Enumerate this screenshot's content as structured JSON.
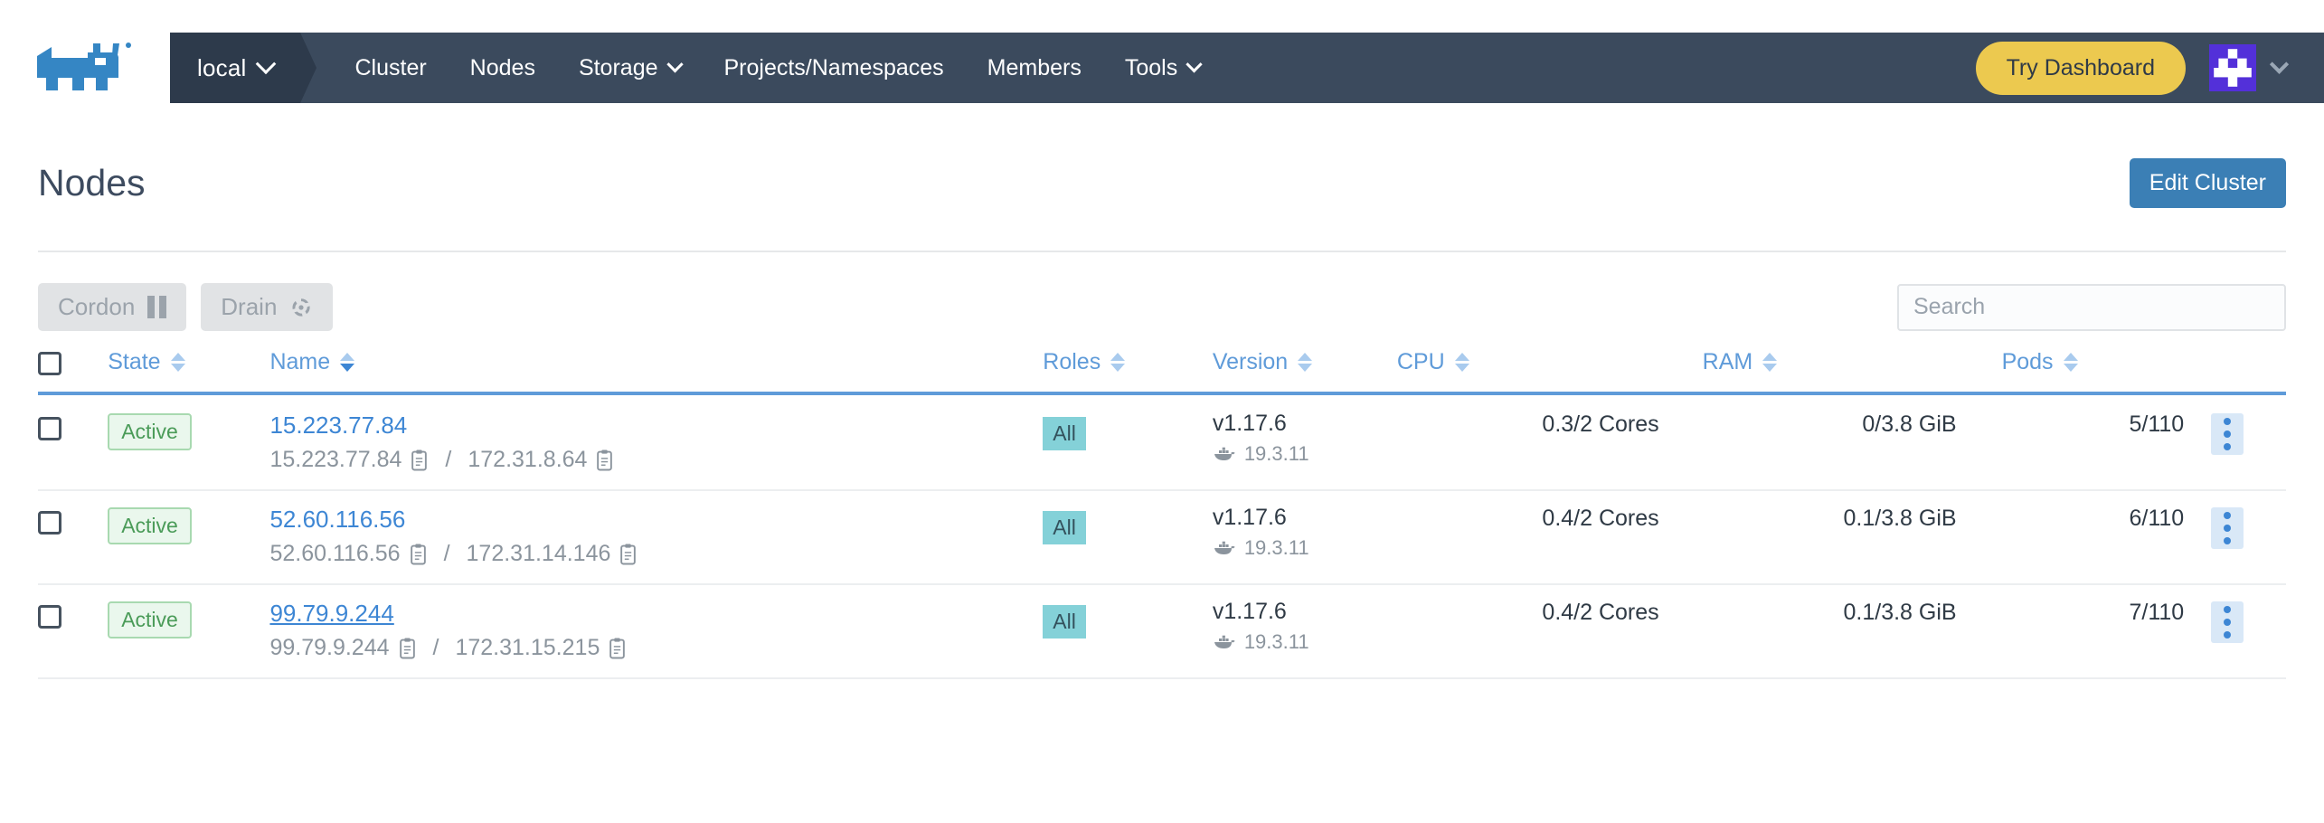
{
  "nav": {
    "logo_icon": "rancher-bull-logo",
    "cluster_selector": {
      "label": "local",
      "icon": "chevron-down-icon"
    },
    "items": [
      {
        "label": "Cluster",
        "has_dropdown": false
      },
      {
        "label": "Nodes",
        "has_dropdown": false
      },
      {
        "label": "Storage",
        "has_dropdown": true
      },
      {
        "label": "Projects/Namespaces",
        "has_dropdown": false
      },
      {
        "label": "Members",
        "has_dropdown": false
      },
      {
        "label": "Tools",
        "has_dropdown": true
      }
    ],
    "try_dashboard_label": "Try Dashboard",
    "avatar_icon": "user-avatar",
    "avatar_chevron_icon": "chevron-down-icon",
    "colors": {
      "nav_bg": "#3b4a5d",
      "local_bg": "#2d3a4b",
      "try_dashboard_bg": "#ecc94f",
      "avatar_bg": "#5330d9"
    }
  },
  "page": {
    "title": "Nodes",
    "edit_cluster_label": "Edit Cluster",
    "edit_cluster_color": "#3b7fb5"
  },
  "actions": {
    "cordon_label": "Cordon",
    "cordon_icon": "pause-icon",
    "drain_label": "Drain",
    "drain_icon": "drain-refresh-icon",
    "search_placeholder": "Search",
    "search_value": ""
  },
  "table": {
    "select_all_checkbox": "unchecked",
    "columns": [
      {
        "label": "State",
        "sort": "inactive",
        "sort_icon": "sort-arrows-icon"
      },
      {
        "label": "Name",
        "sort": "active-desc",
        "sort_icon": "sort-arrows-icon"
      },
      {
        "label": "Roles",
        "sort": "inactive",
        "sort_icon": "sort-arrows-icon"
      },
      {
        "label": "Version",
        "sort": "inactive",
        "sort_icon": "sort-arrows-icon"
      },
      {
        "label": "CPU",
        "sort": "inactive",
        "sort_icon": "sort-arrows-icon"
      },
      {
        "label": "RAM",
        "sort": "inactive",
        "sort_icon": "sort-arrows-icon"
      },
      {
        "label": "Pods",
        "sort": "inactive",
        "sort_icon": "sort-arrows-icon"
      }
    ],
    "rows": [
      {
        "checkbox": "unchecked",
        "state": "Active",
        "name": "15.223.77.84",
        "name_hovered": false,
        "external_ip": "15.223.77.84",
        "internal_ip": "172.31.8.64",
        "ip_separator": "/",
        "copy_icon": "clipboard-copy-icon",
        "roles": "All",
        "version": "v1.17.6",
        "docker_version": "19.3.11",
        "docker_icon": "docker-whale-icon",
        "cpu": "0.3/2 Cores",
        "ram": "0/3.8 GiB",
        "pods": "5/110",
        "menu_icon": "kebab-menu-icon"
      },
      {
        "checkbox": "unchecked",
        "state": "Active",
        "name": "52.60.116.56",
        "name_hovered": false,
        "external_ip": "52.60.116.56",
        "internal_ip": "172.31.14.146",
        "ip_separator": "/",
        "copy_icon": "clipboard-copy-icon",
        "roles": "All",
        "version": "v1.17.6",
        "docker_version": "19.3.11",
        "docker_icon": "docker-whale-icon",
        "cpu": "0.4/2 Cores",
        "ram": "0.1/3.8 GiB",
        "pods": "6/110",
        "menu_icon": "kebab-menu-icon"
      },
      {
        "checkbox": "unchecked",
        "state": "Active",
        "name": "99.79.9.244",
        "name_hovered": true,
        "external_ip": "99.79.9.244",
        "internal_ip": "172.31.15.215",
        "ip_separator": "/",
        "copy_icon": "clipboard-copy-icon",
        "roles": "All",
        "version": "v1.17.6",
        "docker_version": "19.3.11",
        "docker_icon": "docker-whale-icon",
        "cpu": "0.4/2 Cores",
        "ram": "0.1/3.8 GiB",
        "pods": "7/110",
        "menu_icon": "kebab-menu-icon"
      }
    ],
    "colors": {
      "header_text": "#5f9bd9",
      "header_rule": "#5f9bd9",
      "link": "#3d86d4",
      "state_badge_text": "#4a9b58",
      "state_badge_bg": "#eaf7ed",
      "role_badge_bg": "#84d1d8"
    }
  }
}
